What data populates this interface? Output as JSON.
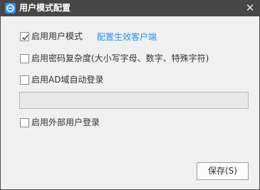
{
  "window": {
    "title": "用户模式配置",
    "close_glyph": "✕"
  },
  "options": {
    "user_mode": {
      "label": "启用用户模式",
      "checked": true,
      "link": "配置生效客户端"
    },
    "password_complexity": {
      "label": "启用密码复杂度(大小写字母、数字、特殊字符)",
      "checked": false
    },
    "ad_login": {
      "label": "启用AD域自动登录",
      "checked": false
    },
    "ad_domain": {
      "value": "",
      "placeholder": ""
    },
    "external_login": {
      "label": "启用外部用户登录",
      "checked": false
    }
  },
  "actions": {
    "save_label": "保存(S)"
  },
  "colors": {
    "titlebar": "#474747",
    "accent": "#2c8cf0",
    "background": "#f0f0f0"
  }
}
